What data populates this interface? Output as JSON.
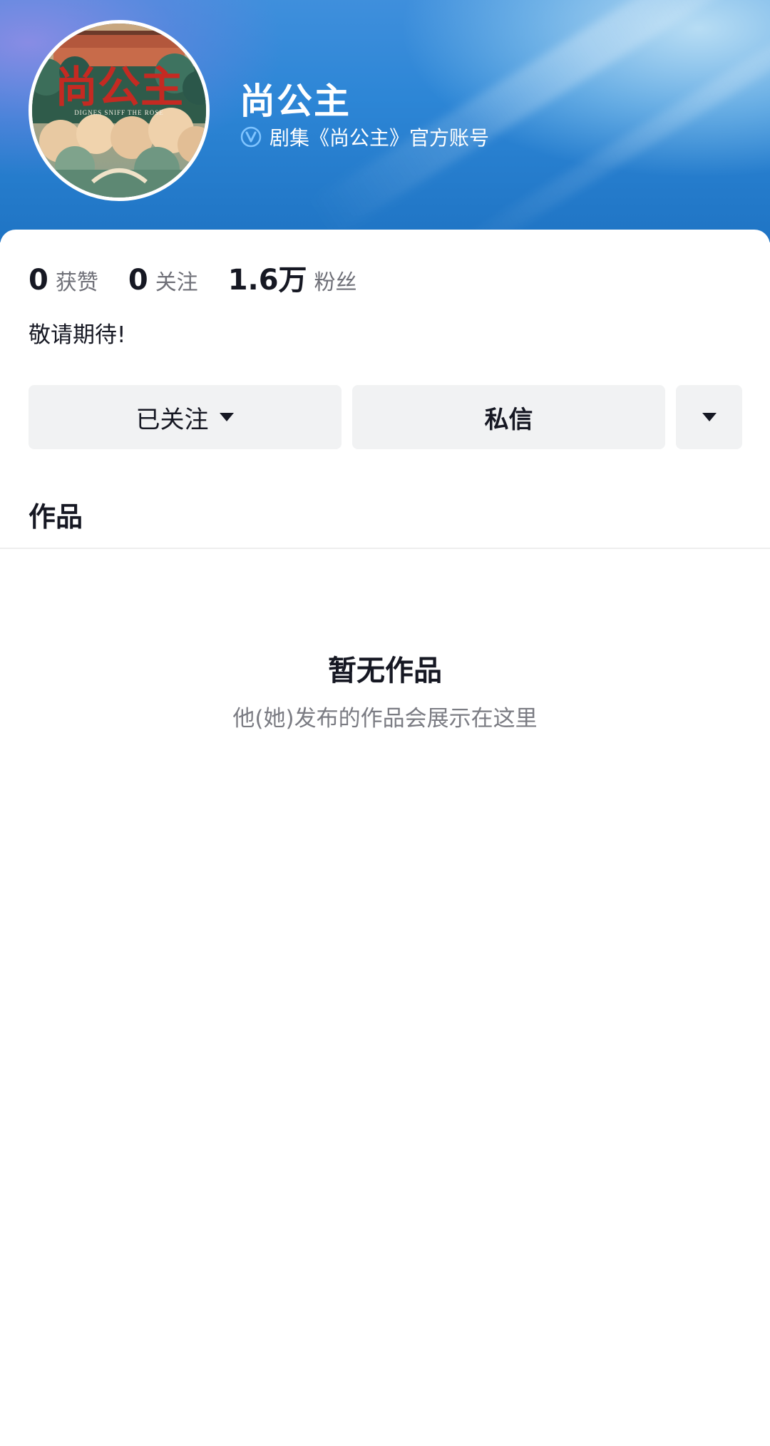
{
  "profile": {
    "name": "尚公主",
    "verification": "剧集《尚公主》官方账号",
    "verify_icon": "verified-v-icon",
    "bio": "敬请期待!",
    "avatar": {
      "title_art": "尚公主",
      "subtitle_art": "DIGNES SNIFF THE ROSE"
    }
  },
  "stats": [
    {
      "value": "0",
      "label": "获赞"
    },
    {
      "value": "0",
      "label": "关注"
    },
    {
      "value": "1.6万",
      "label": "粉丝"
    }
  ],
  "actions": {
    "follow_label": "已关注",
    "message_label": "私信",
    "more_icon": "caret-down-icon"
  },
  "works": {
    "section_title": "作品",
    "empty_title": "暂无作品",
    "empty_subtitle": "他(她)发布的作品会展示在这里"
  },
  "colors": {
    "banner_blue": "#2d86d6",
    "button_bg": "#f1f2f3",
    "text_primary": "#161823",
    "text_secondary": "#6f7078"
  }
}
